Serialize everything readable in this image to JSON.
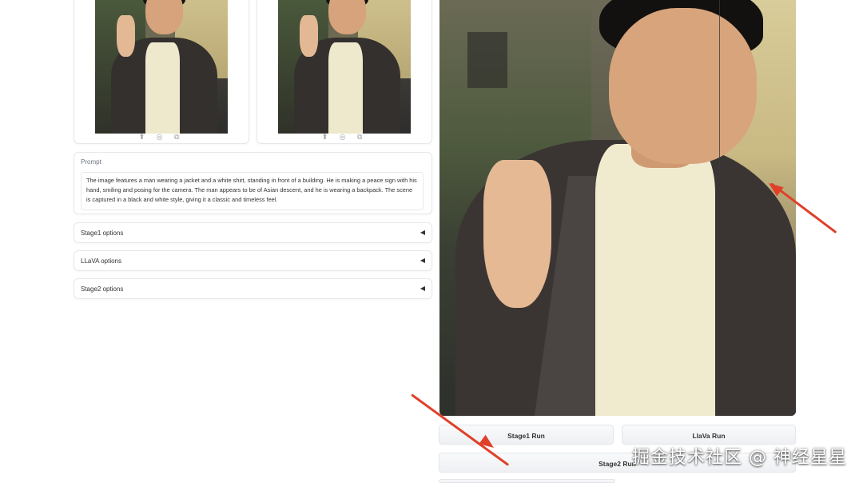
{
  "thumbnails": [
    {
      "icons": "⬆ ◎ ⧉"
    },
    {
      "icons": "⬆ ◎ ⧉"
    }
  ],
  "prompt": {
    "label": "Prompt",
    "value": "The image features a man wearing a jacket and a white shirt, standing in front of a building. He is making a peace sign with his hand, smiling and posing for the camera. The man appears to be of Asian descent, and he is wearing a backpack. The scene is captured in a black and white style, giving it a classic and timeless feel."
  },
  "accordions": [
    {
      "title": "Stage1 options",
      "caret": "◀"
    },
    {
      "title": "LLaVA options",
      "caret": "◀"
    },
    {
      "title": "Stage2 options",
      "caret": "◀"
    }
  ],
  "buttons": {
    "stage1": "Stage1 Run",
    "llava": "LlaVa Run",
    "stage2": "Stage2 Run"
  },
  "watermark": "掘金技术社区 @ 神经星星",
  "colors": {
    "arrow": "#e0402a",
    "border": "#e6e8ec"
  }
}
